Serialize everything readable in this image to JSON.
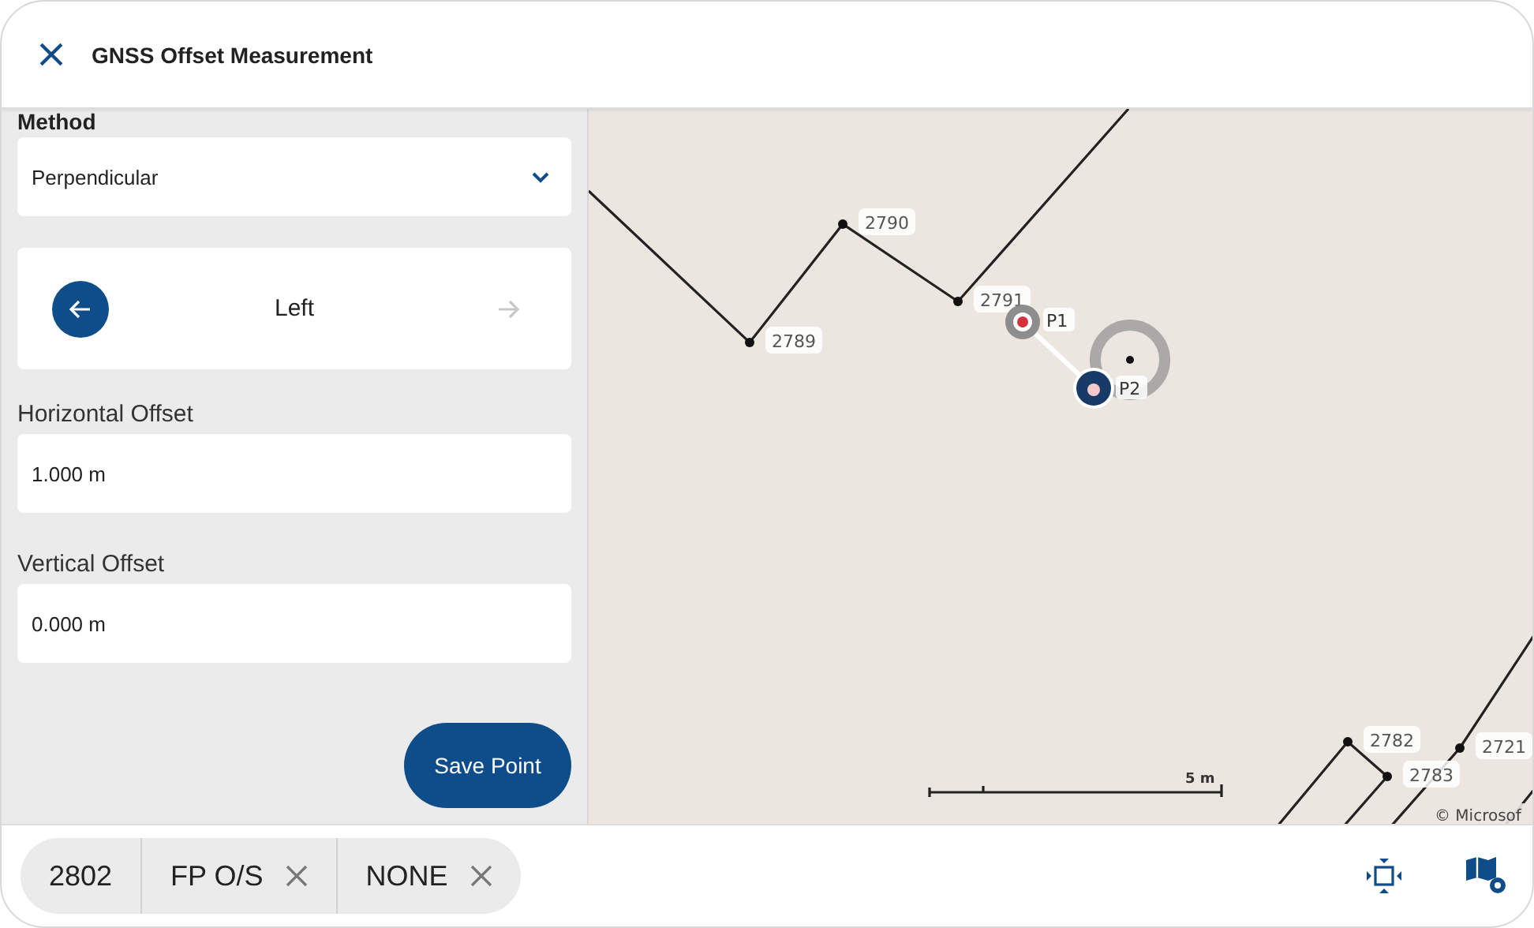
{
  "window": {
    "title": "GNSS Offset Measurement"
  },
  "form": {
    "method": {
      "label": "Method",
      "value": "Perpendicular"
    },
    "direction": {
      "label": "Left",
      "options": [
        {
          "kind": "left",
          "selected": true
        },
        {
          "kind": "right",
          "selected": false
        }
      ]
    },
    "fields": [
      {
        "label": "Horizontal Offset",
        "value": "1.000 m"
      },
      {
        "label": "Vertical Offset",
        "value": "0.000 m"
      }
    ],
    "save_button": "Save Point"
  },
  "map": {
    "points": [
      {
        "label": "2789"
      },
      {
        "label": "2790"
      },
      {
        "label": "2791"
      },
      {
        "label": "2782"
      },
      {
        "label": "2783"
      },
      {
        "label": "2721"
      }
    ],
    "markers": [
      {
        "label": "P1",
        "kind": "source"
      },
      {
        "label": "P2",
        "kind": "target"
      }
    ],
    "scale": "5 m",
    "attribution": "© Microsof"
  },
  "status_bar": {
    "chips": [
      {
        "label": "2802",
        "removable": false
      },
      {
        "label": "FP O/S",
        "removable": true
      },
      {
        "label": "NONE",
        "removable": true
      }
    ]
  }
}
